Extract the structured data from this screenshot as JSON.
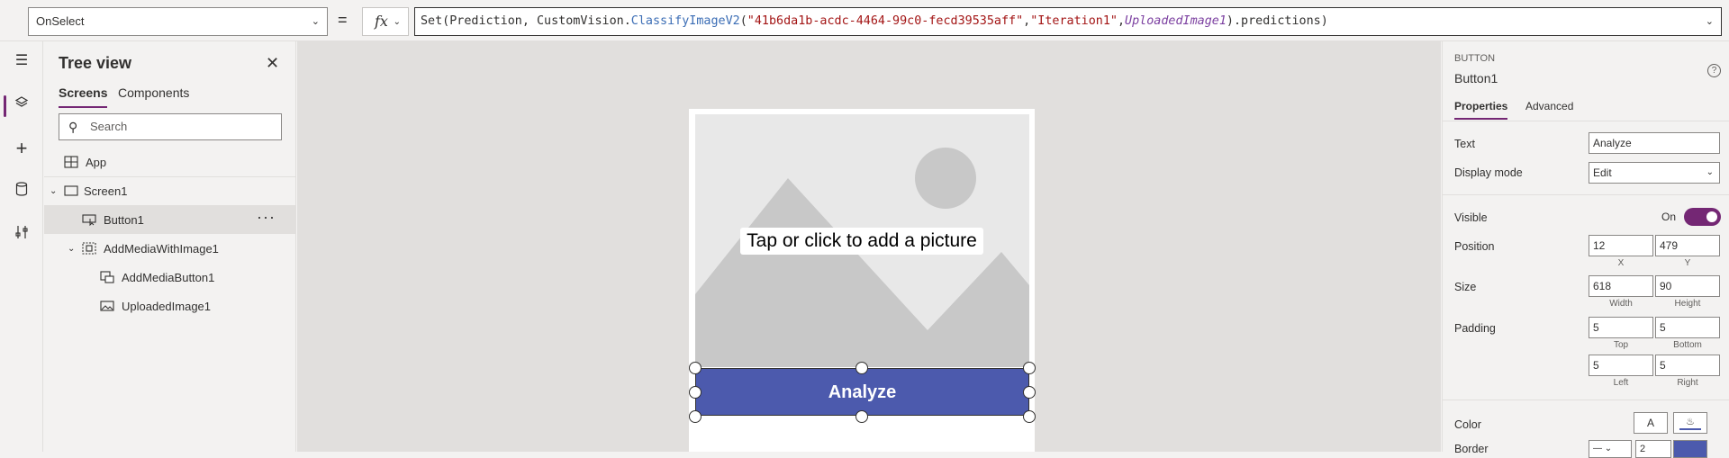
{
  "formula_bar": {
    "property": "OnSelect",
    "equals": "=",
    "fx_label": "fx",
    "formula_parts": {
      "p1": "Set(Prediction, CustomVision.",
      "p2": "ClassifyImageV2",
      "p3": "(",
      "p4": "\"41b6da1b-acdc-4464-99c0-fecd39535aff\"",
      "p5": ",",
      "p6": "\"Iteration1\"",
      "p7": ",",
      "p8": "UploadedImage1",
      "p9": ").predictions)"
    }
  },
  "tree_view": {
    "title": "Tree view",
    "tabs": [
      "Screens",
      "Components"
    ],
    "search_placeholder": "Search",
    "items": [
      {
        "label": "App"
      },
      {
        "label": "Screen1"
      },
      {
        "label": "Button1"
      },
      {
        "label": "AddMediaWithImage1"
      },
      {
        "label": "AddMediaButton1"
      },
      {
        "label": "UploadedImage1"
      }
    ],
    "more_label": "···"
  },
  "canvas": {
    "media_label": "Tap or click to add a picture",
    "button_label": "Analyze",
    "colors": {
      "button": "#4c5aad",
      "media_bg": "#e8e8e8",
      "mountain": "#c8c8c8",
      "sun": "#c8c8c8"
    }
  },
  "properties": {
    "control_type": "BUTTON",
    "control_name": "Button1",
    "tabs": [
      "Properties",
      "Advanced"
    ],
    "text_label": "Text",
    "text_value": "Analyze",
    "display_mode_label": "Display mode",
    "display_mode_value": "Edit",
    "visible_label": "Visible",
    "visible_value": "On",
    "position_label": "Position",
    "position_x": "12",
    "position_y": "479",
    "x_sub": "X",
    "y_sub": "Y",
    "size_label": "Size",
    "size_width": "618",
    "size_height": "90",
    "width_sub": "Width",
    "height_sub": "Height",
    "padding_label": "Padding",
    "padding_top": "5",
    "padding_bottom": "5",
    "padding_left": "5",
    "padding_right": "5",
    "top_sub": "Top",
    "bottom_sub": "Bottom",
    "left_sub": "Left",
    "right_sub": "Right",
    "color_label": "Color",
    "color_a": "A",
    "border_label": "Border",
    "border_value": "2",
    "accent": "#742774"
  }
}
